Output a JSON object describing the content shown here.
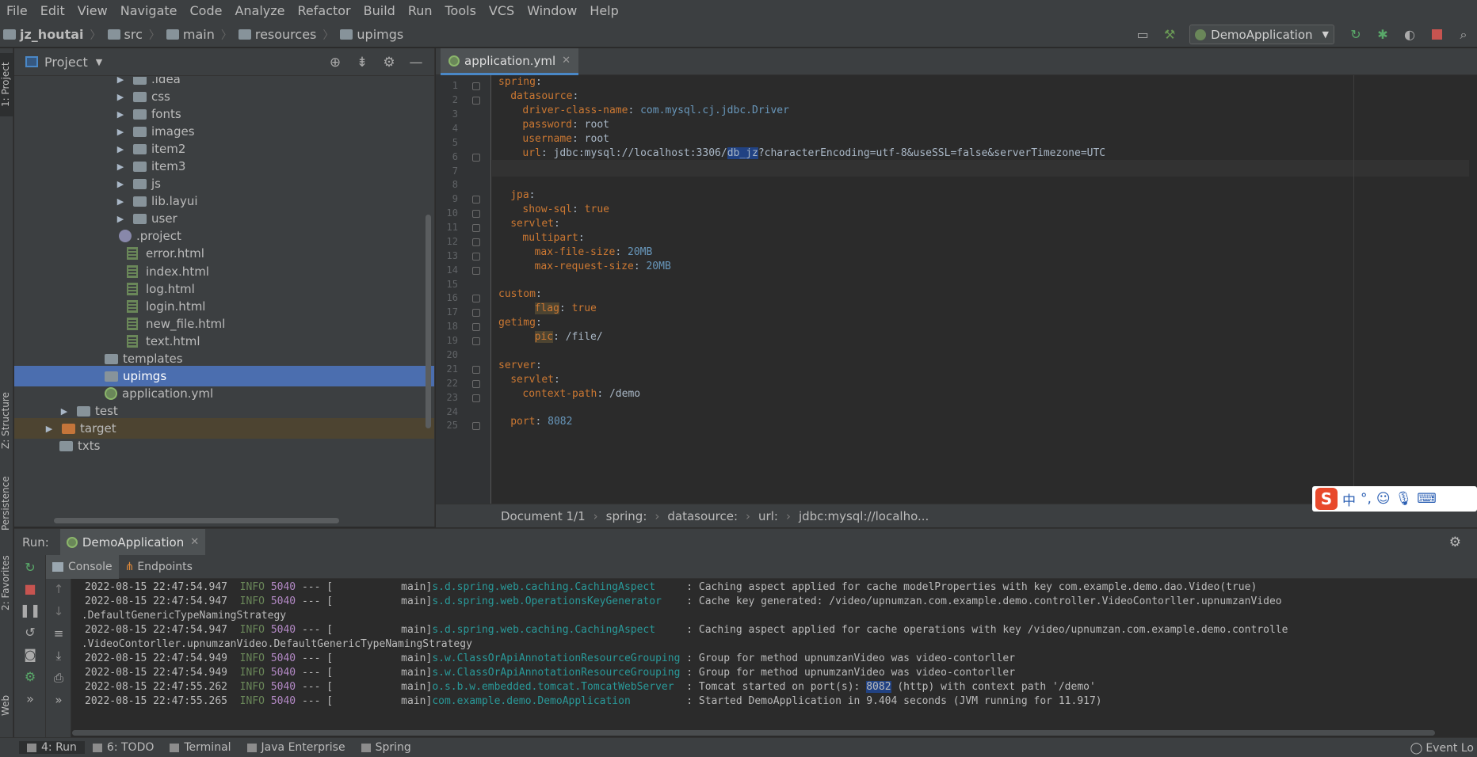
{
  "menu": [
    "File",
    "Edit",
    "View",
    "Navigate",
    "Code",
    "Analyze",
    "Refactor",
    "Build",
    "Run",
    "Tools",
    "VCS",
    "Window",
    "Help"
  ],
  "breadcrumb": [
    "jz_houtai",
    "src",
    "main",
    "resources",
    "upimgs"
  ],
  "run_config": "DemoApplication",
  "left_strip": {
    "project": "1: Project",
    "structure": "Z: Structure",
    "persistence": "Persistence",
    "favorites": "2: Favorites",
    "web": "Web"
  },
  "project_panel": {
    "title": "Project",
    "tree": [
      {
        "label": ".idea",
        "type": "folder",
        "expandable": true
      },
      {
        "label": "css",
        "type": "folder",
        "expandable": true
      },
      {
        "label": "fonts",
        "type": "folder",
        "expandable": true
      },
      {
        "label": "images",
        "type": "folder",
        "expandable": true
      },
      {
        "label": "item2",
        "type": "folder",
        "expandable": true
      },
      {
        "label": "item3",
        "type": "folder",
        "expandable": true
      },
      {
        "label": "js",
        "type": "folder",
        "expandable": true
      },
      {
        "label": "lib.layui",
        "type": "folder",
        "expandable": true
      },
      {
        "label": "user",
        "type": "folder",
        "expandable": true
      },
      {
        "label": ".project",
        "type": "file"
      },
      {
        "label": "error.html",
        "type": "html"
      },
      {
        "label": "index.html",
        "type": "html"
      },
      {
        "label": "log.html",
        "type": "html"
      },
      {
        "label": "login.html",
        "type": "html"
      },
      {
        "label": "new_file.html",
        "type": "html"
      },
      {
        "label": "text.html",
        "type": "html"
      },
      {
        "label": "templates",
        "type": "folder"
      },
      {
        "label": "upimgs",
        "type": "folder",
        "selected": true
      },
      {
        "label": "application.yml",
        "type": "yml"
      },
      {
        "label": "test",
        "type": "folder",
        "expandable": true
      },
      {
        "label": "target",
        "type": "folder",
        "expandable": true
      },
      {
        "label": "txts",
        "type": "folder"
      }
    ]
  },
  "editor": {
    "tab": "application.yml",
    "line_numbers": [
      "1",
      "2",
      "3",
      "4",
      "5",
      "6",
      "7",
      "8",
      "9",
      "10",
      "11",
      "12",
      "13",
      "14",
      "15",
      "16",
      "17",
      "18",
      "19",
      "20",
      "21",
      "22",
      "23",
      "24",
      "25"
    ],
    "lines": [
      {
        "key": "spring",
        "sep": ":",
        "val": ""
      },
      {
        "key": "datasource",
        "sep": ":",
        "val": ""
      },
      {
        "key": "driver-class-name",
        "sep": ": ",
        "val": "com.mysql.cj.jdbc.Driver"
      },
      {
        "key": "password",
        "sep": ": ",
        "val": "root"
      },
      {
        "key": "username",
        "sep": ": ",
        "val": "root"
      },
      {
        "key": "url",
        "sep": ": ",
        "val_pre": "jdbc:mysql://localhost:3306/",
        "val_hl": "db_jz",
        "val_post": "?characterEncoding=utf-8&useSSL=false&serverTimezone=UTC"
      },
      {
        "key": "",
        "sep": "",
        "val": ""
      },
      {
        "key": "",
        "sep": "",
        "val": ""
      },
      {
        "key": "jpa",
        "sep": ":",
        "val": ""
      },
      {
        "key": "show-sql",
        "sep": ": ",
        "val": "true"
      },
      {
        "key": "servlet",
        "sep": ":",
        "val": ""
      },
      {
        "key": "multipart",
        "sep": ":",
        "val": ""
      },
      {
        "key": "max-file-size",
        "sep": ": ",
        "val": "20MB"
      },
      {
        "key": "max-request-size",
        "sep": ": ",
        "val": "20MB"
      },
      {
        "key": "",
        "sep": "",
        "val": ""
      },
      {
        "key": "custom",
        "sep": ":",
        "val": ""
      },
      {
        "key": "flag",
        "sep": ": ",
        "val": "true"
      },
      {
        "key": "getimg",
        "sep": ":",
        "val": ""
      },
      {
        "key": "pic",
        "sep": ": ",
        "val": "/file/"
      },
      {
        "key": "",
        "sep": "",
        "val": ""
      },
      {
        "key": "server",
        "sep": ":",
        "val": ""
      },
      {
        "key": "servlet",
        "sep": ":",
        "val": ""
      },
      {
        "key": "context-path",
        "sep": ": ",
        "val": "/demo"
      },
      {
        "key": "",
        "sep": "",
        "val": ""
      },
      {
        "key": "port",
        "sep": ": ",
        "val": "8082"
      }
    ],
    "breadcrumbs": [
      "Document 1/1",
      "spring:",
      "datasource:",
      "url:",
      "jdbc:mysql://localho..."
    ]
  },
  "ime": {
    "lang": "中",
    "punct": "°,"
  },
  "run_panel": {
    "label": "Run:",
    "tab": "DemoApplication",
    "subtabs": [
      "Console",
      "Endpoints"
    ],
    "log": [
      {
        "ts": "2022-08-15 22:47:54.947",
        "lvl": "INFO",
        "pid": "5040",
        "sep": " --- [",
        "thread": "           main]",
        "logger": "s.d.spring.web.caching.CachingAspect    ",
        "msg": " : Caching aspect applied for cache modelProperties with key com.example.demo.dao.Video(true)"
      },
      {
        "ts": "2022-08-15 22:47:54.947",
        "lvl": "INFO",
        "pid": "5040",
        "sep": " --- [",
        "thread": "           main]",
        "logger": "s.d.spring.web.OperationsKeyGenerator   ",
        "msg": " : Cache key generated: /video/upnumzan.com.example.demo.controller.VideoContorller.upnumzanVideo"
      },
      {
        "cont": " .DefaultGenericTypeNamingStrategy"
      },
      {
        "ts": "2022-08-15 22:47:54.947",
        "lvl": "INFO",
        "pid": "5040",
        "sep": " --- [",
        "thread": "           main]",
        "logger": "s.d.spring.web.caching.CachingAspect    ",
        "msg": " : Caching aspect applied for cache operations with key /video/upnumzan.com.example.demo.controlle"
      },
      {
        "cont": " .VideoContorller.upnumzanVideo.DefaultGenericTypeNamingStrategy"
      },
      {
        "ts": "2022-08-15 22:47:54.949",
        "lvl": "INFO",
        "pid": "5040",
        "sep": " --- [",
        "thread": "           main]",
        "logger": "s.w.ClassOrApiAnnotationResourceGrouping",
        "msg": " : Group for method upnumzanVideo was video-contorller"
      },
      {
        "ts": "2022-08-15 22:47:54.949",
        "lvl": "INFO",
        "pid": "5040",
        "sep": " --- [",
        "thread": "           main]",
        "logger": "s.w.ClassOrApiAnnotationResourceGrouping",
        "msg": " : Group for method upnumzanVideo was video-contorller"
      },
      {
        "ts": "2022-08-15 22:47:55.262",
        "lvl": "INFO",
        "pid": "5040",
        "sep": " --- [",
        "thread": "           main]",
        "logger": "o.s.b.w.embedded.tomcat.TomcatWebServer ",
        "msg_pre": " : Tomcat started on port(s): ",
        "msg_hl": "8082",
        "msg_post": " (http) with context path '/demo'"
      },
      {
        "ts": "2022-08-15 22:47:55.265",
        "lvl": "INFO",
        "pid": "5040",
        "sep": " --- [",
        "thread": "           main]",
        "logger": "com.example.demo.DemoApplication        ",
        "msg": " : Started DemoApplication in 9.404 seconds (JVM running for 11.917)"
      }
    ]
  },
  "bottom_tabs": [
    "4: Run",
    "6: TODO",
    "Terminal",
    "Java Enterprise",
    "Spring"
  ],
  "event_log": "Event Lo"
}
